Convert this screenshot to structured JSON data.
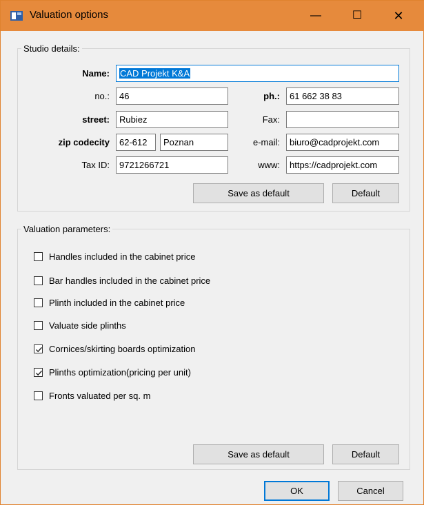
{
  "window": {
    "title": "Valuation options",
    "minimize": "—",
    "maximize": "☐",
    "close": "✕"
  },
  "studio": {
    "group_title": "Studio details:",
    "name_label": "Name:",
    "name_value": "CAD Projekt  K&A",
    "no_label": "no.:",
    "no_value": "46",
    "ph_label": "ph.:",
    "ph_value": "61 662 38 83",
    "street_label": "street:",
    "street_value": "Rubiez",
    "fax_label": "Fax:",
    "fax_value": "",
    "zip_label": "zip codecity",
    "zip_value": "62-612",
    "city_value": "Poznan",
    "email_label": "e-mail:",
    "email_value": "biuro@cadprojekt.com",
    "taxid_label": "Tax ID:",
    "taxid_value": "9721266721",
    "www_label": "www:",
    "www_value": "https://cadprojekt.com",
    "save_default_label": "Save as default",
    "default_label": "Default"
  },
  "valuation": {
    "group_title": "Valuation parameters:",
    "options": [
      {
        "label": "Handles included in the cabinet price",
        "checked": false
      },
      {
        "label": "Bar handles included in the cabinet price",
        "checked": false
      },
      {
        "label": "Plinth included in the cabinet price",
        "checked": false
      },
      {
        "label": "Valuate side plinths",
        "checked": false
      },
      {
        "label": "Cornices/skirting boards optimization",
        "checked": true
      },
      {
        "label": "Plinths optimization(pricing per unit)",
        "checked": true
      },
      {
        "label": "Fronts valuated per sq. m",
        "checked": false
      }
    ],
    "save_default_label": "Save as default",
    "default_label": "Default"
  },
  "footer": {
    "ok_label": "OK",
    "cancel_label": "Cancel"
  },
  "colors": {
    "titlebar": "#e68a3c",
    "selection": "#0078d7"
  }
}
